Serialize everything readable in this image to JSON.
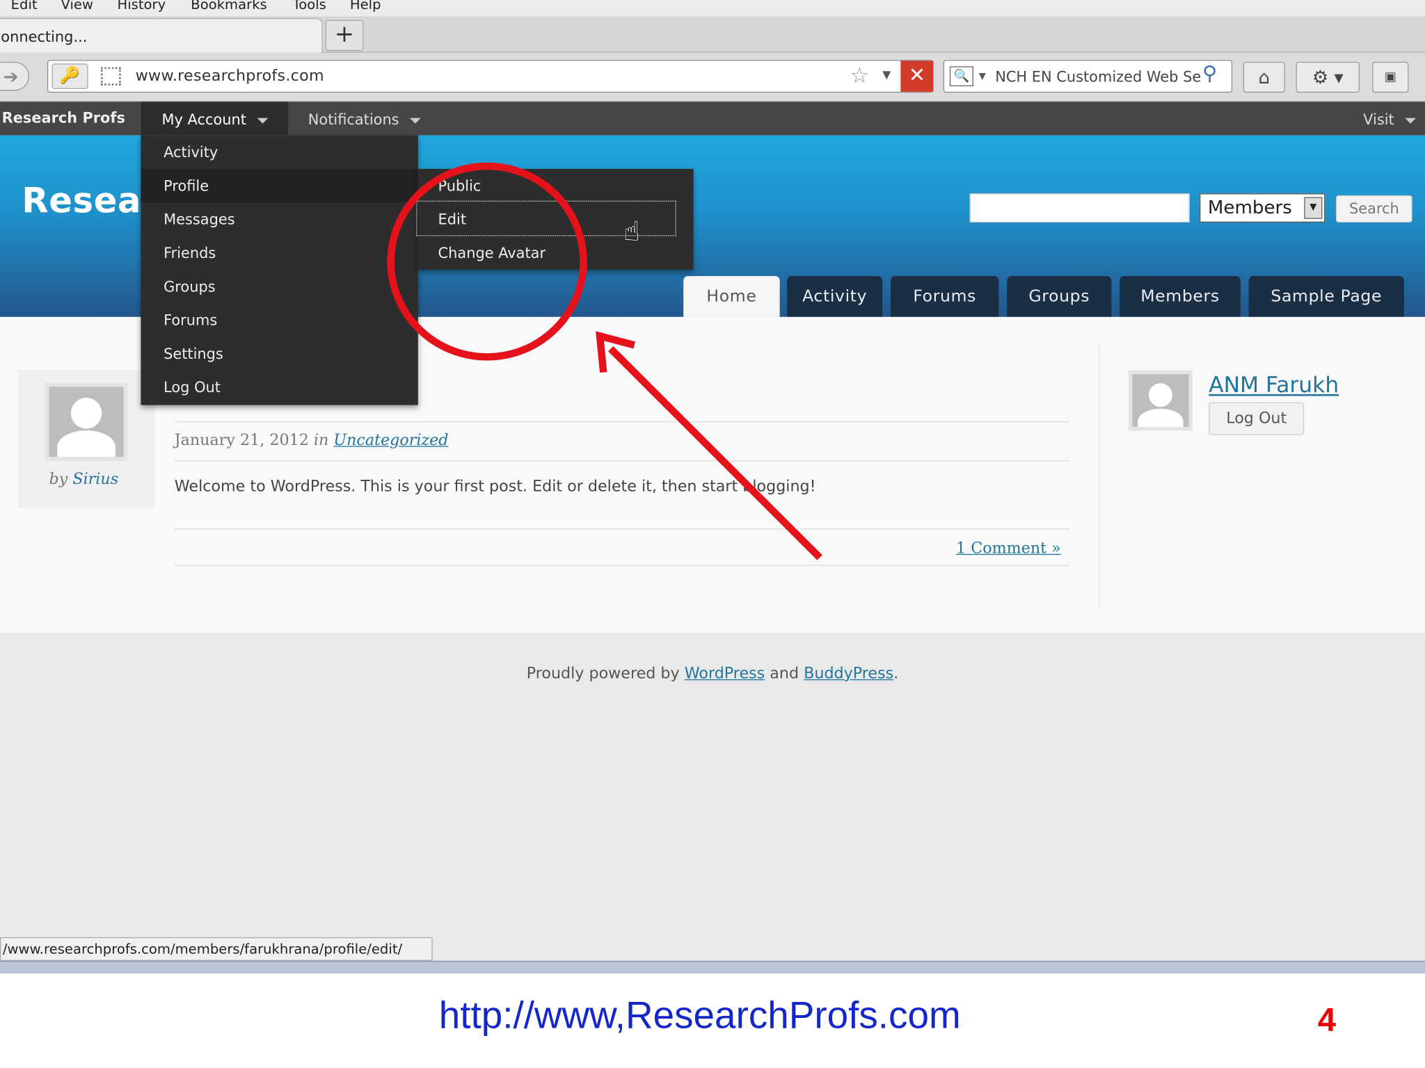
{
  "browser": {
    "menu": [
      "Edit",
      "View",
      "History",
      "Bookmarks",
      "Tools",
      "Help"
    ],
    "tab_title": "onnecting...",
    "new_tab_symbol": "+",
    "url": "www.researchprofs.com",
    "search_placeholder": "NCH EN Customized Web Sea",
    "status_url": "/www.researchprofs.com/members/farukhrana/profile/edit/"
  },
  "adminbar": {
    "brand": "Research Profs",
    "my_account": "My Account",
    "notifications": "Notifications",
    "visit": "Visit",
    "menu_items": [
      "Activity",
      "Profile",
      "Messages",
      "Friends",
      "Groups",
      "Forums",
      "Settings",
      "Log Out"
    ],
    "submenu_items": [
      "Public",
      "Edit",
      "Change Avatar"
    ]
  },
  "header": {
    "site_title": "Resear",
    "search_scope": "Members",
    "search_button": "Search",
    "nav_tabs": [
      "Home",
      "Activity",
      "Forums",
      "Groups",
      "Members",
      "Sample Page"
    ]
  },
  "post": {
    "by_label": "by",
    "author": "Sirius",
    "date": "January 21, 2012",
    "in_label": "in",
    "category": "Uncategorized",
    "text": "Welcome to WordPress. This is your first post. Edit or delete it, then start blogging!",
    "comments_link": "1 Comment »"
  },
  "sidebar": {
    "user_name": "ANM Farukh",
    "logout_button": "Log Out"
  },
  "footer": {
    "prefix": "Proudly powered by",
    "link1": "WordPress",
    "and": "and",
    "link2": "BuddyPress",
    "suffix": "."
  },
  "slide": {
    "url": "http://www,ResearchProfs.com",
    "page_number": "4"
  },
  "colors": {
    "annotation_red": "#e5121b",
    "link_blue": "#21759b",
    "admin_bar": "#464646",
    "slide_url_blue": "#1427c9"
  }
}
